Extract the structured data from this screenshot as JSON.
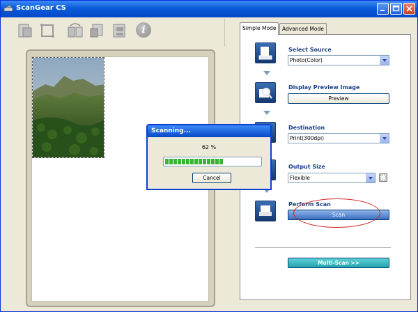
{
  "window": {
    "title": "ScanGear CS"
  },
  "toolbar": {
    "icons": [
      "scan-area-icon",
      "crop-icon",
      "rotate-icon",
      "auto-crop-icon",
      "multi-crop-icon",
      "info-icon"
    ],
    "info_glyph": "i"
  },
  "tabs": [
    {
      "label": "Simple Mode",
      "active": true
    },
    {
      "label": "Advanced Mode",
      "active": false
    }
  ],
  "steps": {
    "select_source": {
      "label": "Select Source",
      "value": "Photo(Color)"
    },
    "display_preview": {
      "label": "Display Preview Image",
      "button": "Preview"
    },
    "destination": {
      "label": "Destination",
      "value": "Print(300dpi)"
    },
    "output_size": {
      "label": "Output Size",
      "value": "Flexible"
    },
    "perform_scan": {
      "label": "Perform Scan",
      "button": "Scan"
    }
  },
  "multi_scan": {
    "label": "Multi-Scan >>"
  },
  "dialog": {
    "title": "Scanning...",
    "percent_text": "62 %",
    "progress": 0.62,
    "cancel": "Cancel"
  },
  "colors": {
    "titlebar": "#0a5bd9",
    "step_label": "#1c3f86",
    "multi_scan": "#23a2ad",
    "highlight": "#d42020"
  }
}
